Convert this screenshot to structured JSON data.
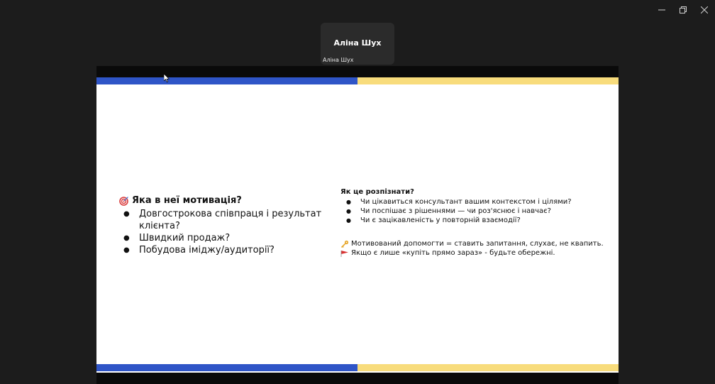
{
  "window": {
    "controls": [
      {
        "name": "minimize-icon"
      },
      {
        "name": "restore-icon"
      },
      {
        "name": "close-icon"
      }
    ]
  },
  "participant": {
    "display_name": "Аліна Шух",
    "label": "Аліна Шух"
  },
  "slide": {
    "colors": {
      "blue": "#2f55c7",
      "yellow": "#f8dc7c"
    },
    "left": {
      "icon": "target-icon",
      "title": "Яка в неї мотивація?",
      "items": [
        "Довгострокова співпраця і результат клієнта?",
        "Швидкий продаж?",
        "Побудова іміджу/аудиторії?"
      ]
    },
    "right": {
      "title": "Як це розпізнати?",
      "items": [
        "Чи цікавиться консультант вашим контекстом і цілями?",
        "Чи поспішає з рішеннями — чи роз'яснює і навчає?",
        "Чи є зацікавленість у повторній взаємодії?"
      ],
      "notes": [
        {
          "icon": "key-icon",
          "text": "Мотивований допомогти = ставить запитання, слухає, не квапить."
        },
        {
          "icon": "red-flag-icon",
          "text": "Якщо є лише «купіть прямо зараз» - будьте обережні."
        }
      ]
    }
  }
}
